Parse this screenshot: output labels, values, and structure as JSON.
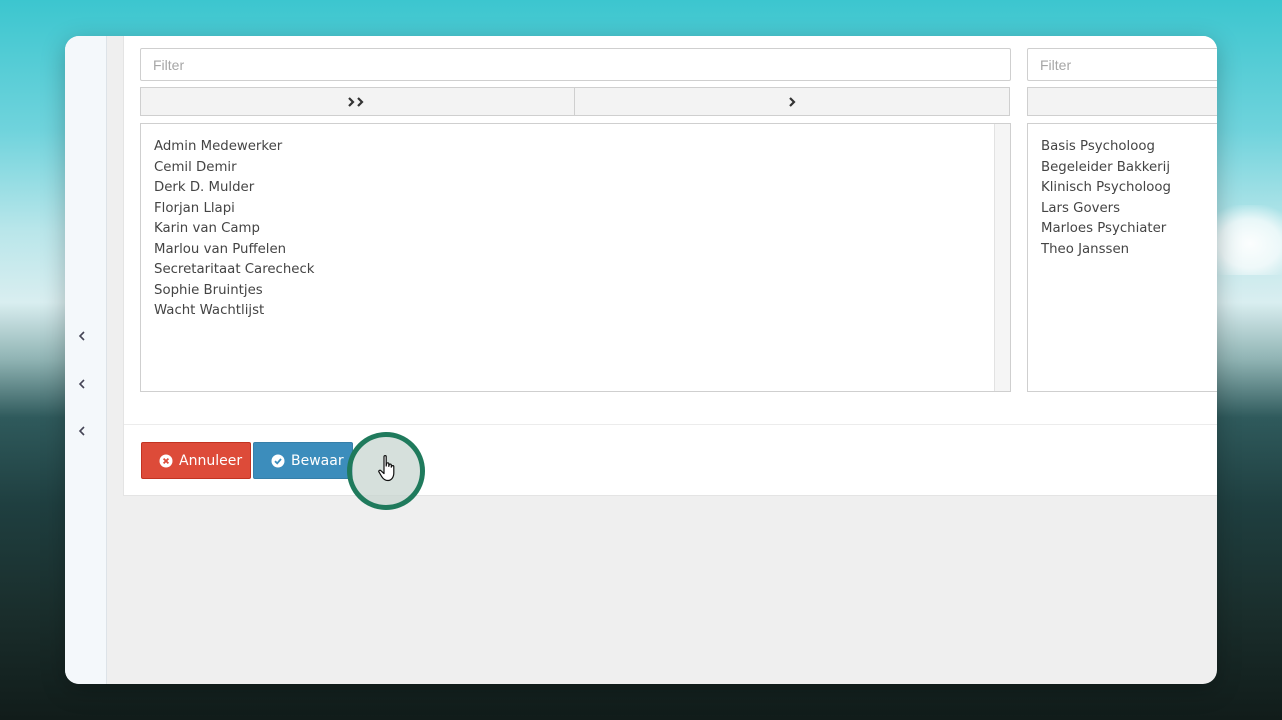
{
  "left_list": {
    "filter_placeholder": "Filter",
    "move_all_icon": "double-chevron-right-icon",
    "move_selected_icon": "chevron-right-icon",
    "items": [
      "Admin Medewerker",
      "Cemil Demir",
      "Derk D. Mulder",
      "Florjan Llapi",
      "Karin van Camp",
      "Marlou van Puffelen",
      "Secretaritaat Carecheck",
      "Sophie Bruintjes",
      "Wacht Wachtlijst"
    ]
  },
  "right_list": {
    "filter_placeholder": "Filter",
    "items": [
      "Basis Psycholoog",
      "Begeleider Bakkerij",
      "Klinisch Psycholoog",
      "Lars Govers",
      "Marloes Psychiater",
      "Theo Janssen"
    ]
  },
  "actions": {
    "cancel_label": "Annuleer",
    "cancel_icon": "times-circle-icon",
    "save_label": "Bewaar",
    "save_icon": "check-circle-icon"
  },
  "sidebar": {
    "toggle_icon": "chevron-left-icon"
  },
  "colors": {
    "cancel": "#dd4b39",
    "save": "#3c8dbc",
    "click_highlight": "#1f7a5c"
  }
}
